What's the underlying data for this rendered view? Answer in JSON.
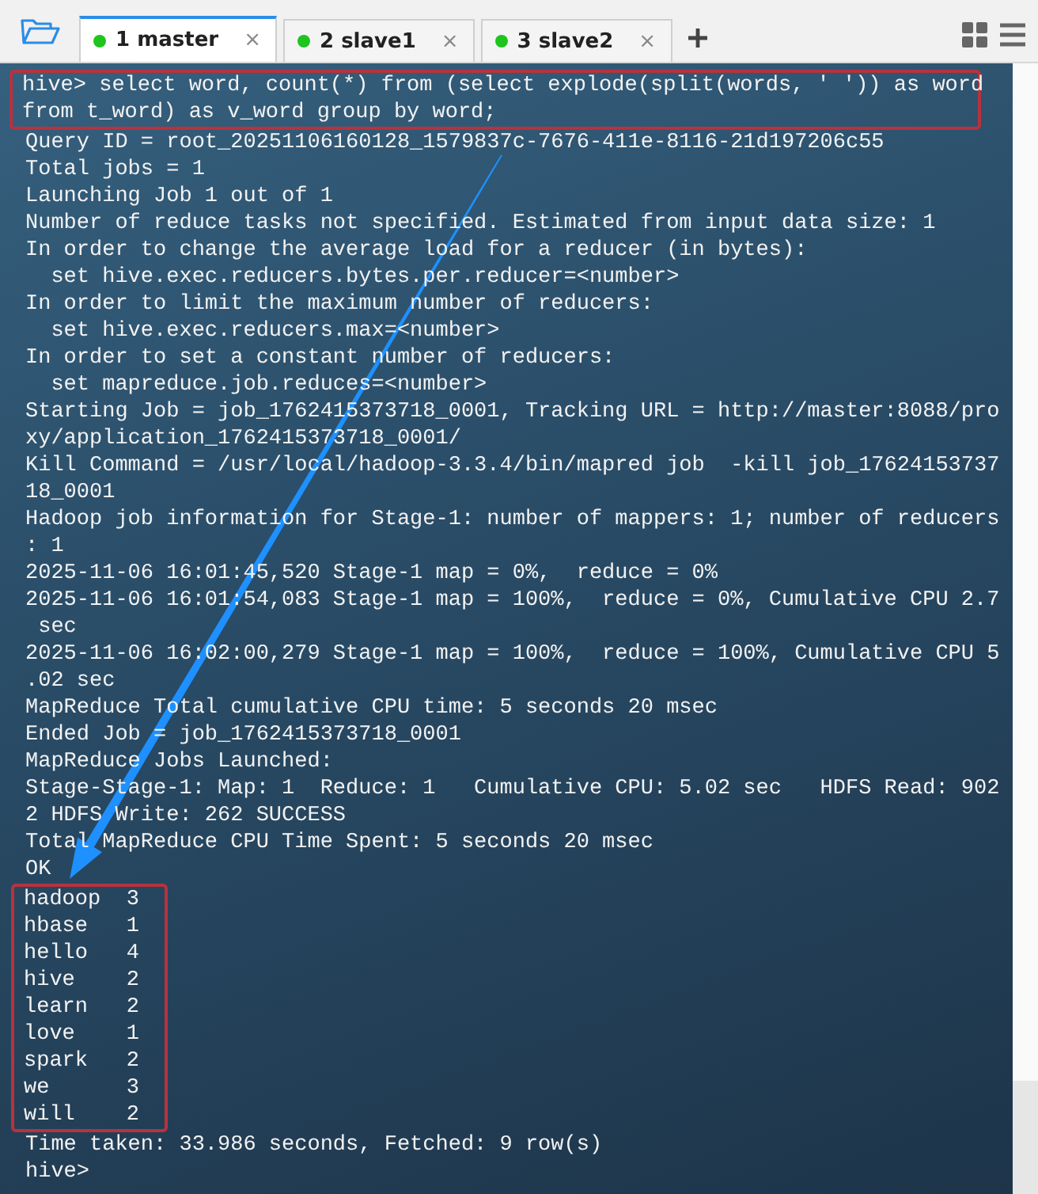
{
  "tabs": [
    {
      "number": "1",
      "label": "master",
      "close": "×",
      "selected": true
    },
    {
      "number": "2",
      "label": "slave1",
      "close": "×",
      "selected": false
    },
    {
      "number": "3",
      "label": "slave2",
      "close": "×",
      "selected": false
    }
  ],
  "terminal": {
    "command": [
      "hive> select word, count(*) from (select explode(split(words, ' ')) as word",
      "from t_word) as v_word group by word;"
    ],
    "output": [
      "Query ID = root_20251106160128_1579837c-7676-411e-8116-21d197206c55",
      "Total jobs = 1",
      "Launching Job 1 out of 1",
      "Number of reduce tasks not specified. Estimated from input data size: 1",
      "In order to change the average load for a reducer (in bytes):",
      "  set hive.exec.reducers.bytes.per.reducer=<number>",
      "In order to limit the maximum number of reducers:",
      "  set hive.exec.reducers.max=<number>",
      "In order to set a constant number of reducers:",
      "  set mapreduce.job.reduces=<number>",
      "Starting Job = job_1762415373718_0001, Tracking URL = http://master:8088/pro",
      "xy/application_1762415373718_0001/",
      "Kill Command = /usr/local/hadoop-3.3.4/bin/mapred job  -kill job_17624153737",
      "18_0001",
      "Hadoop job information for Stage-1: number of mappers: 1; number of reducers",
      ": 1",
      "2025-11-06 16:01:45,520 Stage-1 map = 0%,  reduce = 0%",
      "2025-11-06 16:01:54,083 Stage-1 map = 100%,  reduce = 0%, Cumulative CPU 2.7",
      " sec",
      "2025-11-06 16:02:00,279 Stage-1 map = 100%,  reduce = 100%, Cumulative CPU 5",
      ".02 sec",
      "MapReduce Total cumulative CPU time: 5 seconds 20 msec",
      "Ended Job = job_1762415373718_0001",
      "MapReduce Jobs Launched:",
      "Stage-Stage-1: Map: 1  Reduce: 1   Cumulative CPU: 5.02 sec   HDFS Read: 902",
      "2 HDFS Write: 262 SUCCESS",
      "Total MapReduce CPU Time Spent: 5 seconds 20 msec",
      "OK"
    ],
    "results": [
      {
        "word": "hadoop",
        "count": "3"
      },
      {
        "word": "hbase",
        "count": "1"
      },
      {
        "word": "hello",
        "count": "4"
      },
      {
        "word": "hive",
        "count": "2"
      },
      {
        "word": "learn",
        "count": "2"
      },
      {
        "word": "love",
        "count": "1"
      },
      {
        "word": "spark",
        "count": "2"
      },
      {
        "word": "we",
        "count": "3"
      },
      {
        "word": "will",
        "count": "2"
      }
    ],
    "footer": [
      "Time taken: 33.986 seconds, Fetched: 9 row(s)",
      "hive>"
    ]
  }
}
